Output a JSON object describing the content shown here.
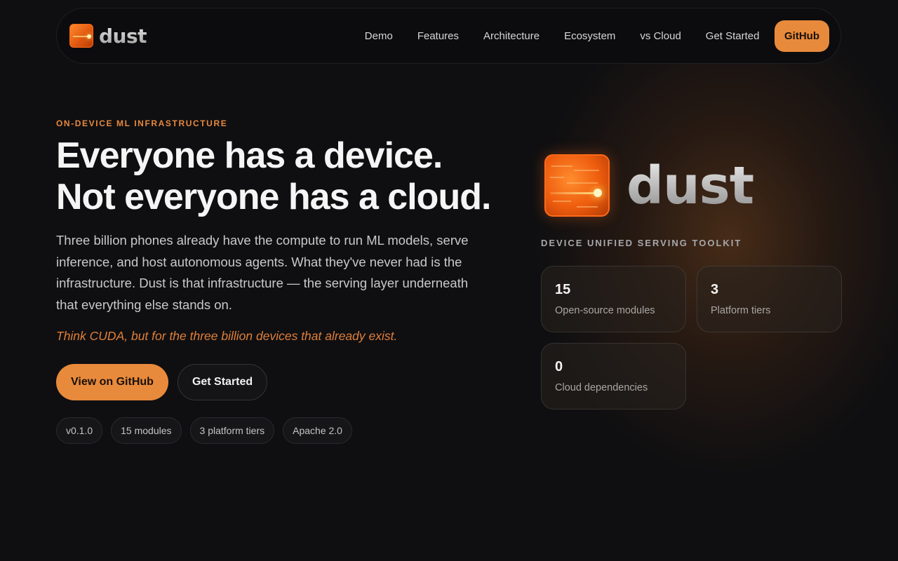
{
  "brand": {
    "name": "dust"
  },
  "nav": {
    "links": [
      "Demo",
      "Features",
      "Architecture",
      "Ecosystem",
      "vs Cloud",
      "Get Started"
    ],
    "cta": "GitHub"
  },
  "hero": {
    "eyebrow": "ON-DEVICE ML INFRASTRUCTURE",
    "headline_line1": "Everyone has a device.",
    "headline_line2": "Not everyone has a cloud.",
    "lede": "Three billion phones already have the compute to run ML models, serve inference, and host autonomous agents. What they've never had is the infrastructure. Dust is that infrastructure — the serving layer underneath that everything else stands on.",
    "tagline": "Think CUDA, but for the three billion devices that already exist.",
    "primary_button": "View on GitHub",
    "secondary_button": "Get Started",
    "pills": [
      "v0.1.0",
      "15 modules",
      "3 platform tiers",
      "Apache 2.0"
    ]
  },
  "showcase": {
    "logo_text": "dust",
    "subtitle": "DEVICE UNIFIED SERVING TOOLKIT",
    "stats": [
      {
        "value": "15",
        "label": "Open-source modules"
      },
      {
        "value": "3",
        "label": "Platform tiers"
      },
      {
        "value": "0",
        "label": "Cloud dependencies"
      }
    ]
  },
  "colors": {
    "accent": "#e88a3c",
    "background": "#0f0f11",
    "logo_orange": "#ee5c0e"
  },
  "icons": {
    "logo": "chip-logo-icon"
  }
}
